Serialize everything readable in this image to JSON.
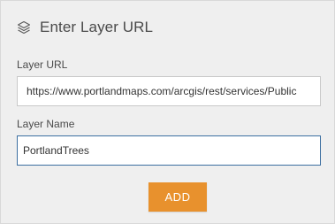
{
  "dialog": {
    "title": "Enter Layer URL",
    "icon": "layers-icon"
  },
  "layer_url": {
    "label": "Layer URL",
    "value": "https://www.portlandmaps.com/arcgis/rest/services/Public"
  },
  "layer_name": {
    "label": "Layer Name",
    "value": "PortlandTrees"
  },
  "actions": {
    "add_label": "ADD"
  },
  "colors": {
    "accent": "#e8912d",
    "focus_border": "#3d6fa1",
    "panel_bg": "#efefef"
  }
}
